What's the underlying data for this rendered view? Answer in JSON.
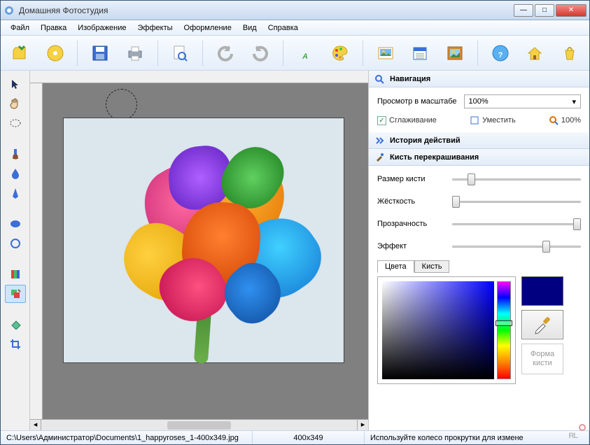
{
  "app": {
    "title": "Домашняя Фотостудия"
  },
  "menu": [
    "Файл",
    "Правка",
    "Изображение",
    "Эффекты",
    "Оформление",
    "Вид",
    "Справка"
  ],
  "toolbar_icons": [
    "open",
    "cd",
    "save",
    "print",
    "preview",
    "undo",
    "redo",
    "text",
    "palette",
    "photo",
    "calendar",
    "frame",
    "help",
    "home",
    "shop"
  ],
  "panels": {
    "nav": {
      "title": "Навигация",
      "scale_label": "Просмотр в масштабе",
      "scale_value": "100%",
      "smoothing": "Сглаживание",
      "fit": "Уместить",
      "hundred": "100%"
    },
    "history": {
      "title": "История действий"
    },
    "brush": {
      "title": "Кисть перекрашивания",
      "size": "Размер кисти",
      "hardness": "Жёсткость",
      "opacity": "Прозрачность",
      "effect": "Эффект",
      "tab_colors": "Цвета",
      "tab_brush": "Кисть",
      "shape": "Форма кисти"
    }
  },
  "status": {
    "path": "C:\\Users\\Администратор\\Documents\\1_happyroses_1-400x349.jpg",
    "dims": "400x349",
    "hint": "Используйте колесо прокрутки для измене"
  },
  "watermark": "RL",
  "colors": {
    "swatch": "#000080"
  }
}
